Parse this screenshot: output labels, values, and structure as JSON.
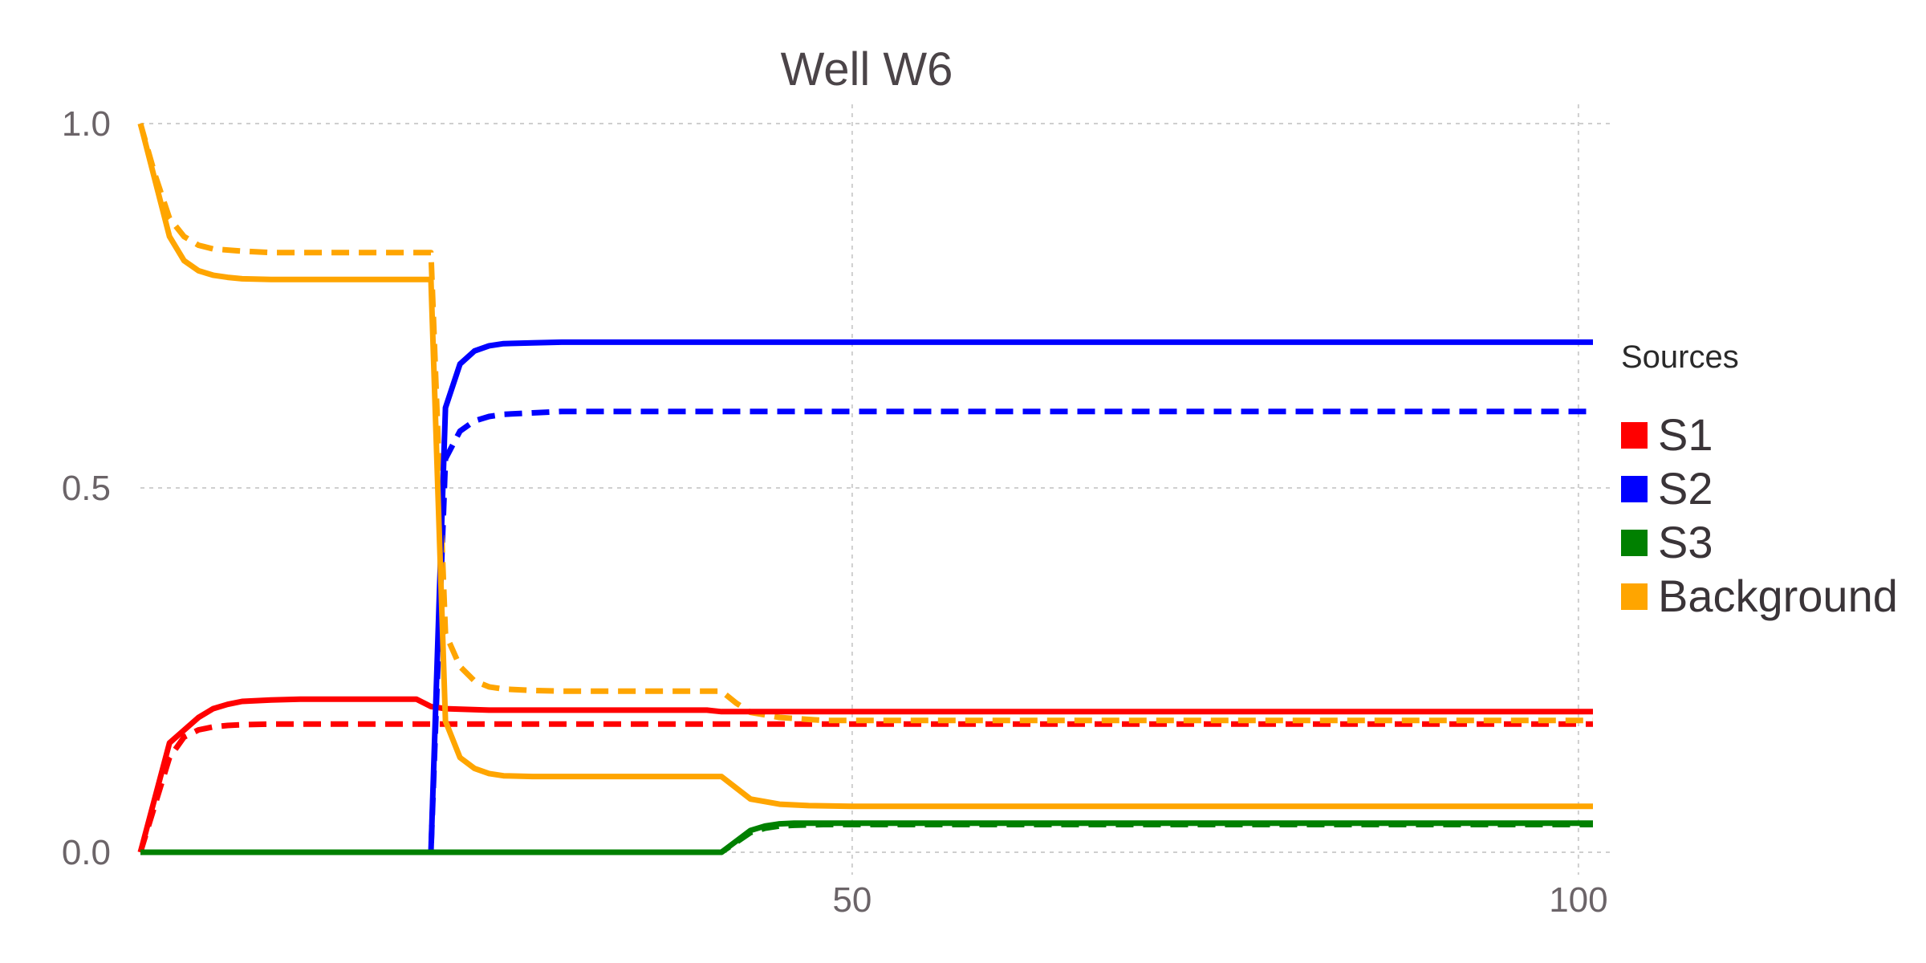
{
  "chart_data": {
    "type": "line",
    "title": "Well W6",
    "xlabel": "",
    "ylabel": "",
    "xlim": [
      1,
      101
    ],
    "ylim": [
      0.0,
      1.0
    ],
    "x_ticks": [
      50,
      100
    ],
    "x_tick_labels": [
      "50",
      "100"
    ],
    "y_ticks": [
      0.0,
      0.5,
      1.0
    ],
    "y_tick_labels": [
      "0.0",
      "0.5",
      "1.0"
    ],
    "grid": true,
    "legend": {
      "title": "Sources",
      "position": "right",
      "items": [
        "S1",
        "S2",
        "S3",
        "Background"
      ]
    },
    "line_styles": [
      "solid",
      "dashed"
    ],
    "series": [
      {
        "name": "S1",
        "style": "solid",
        "color": "#ff0000",
        "x": [
          1,
          3,
          5,
          6,
          7,
          8,
          10,
          12,
          15,
          20,
          21,
          22,
          25,
          30,
          40,
          41,
          101
        ],
        "y": [
          0.0,
          0.15,
          0.185,
          0.197,
          0.203,
          0.207,
          0.209,
          0.21,
          0.21,
          0.21,
          0.2,
          0.197,
          0.195,
          0.195,
          0.195,
          0.193,
          0.193
        ]
      },
      {
        "name": "S1",
        "style": "dashed",
        "color": "#ff0000",
        "x": [
          1,
          3,
          4,
          5,
          6,
          7,
          8,
          10,
          15,
          20,
          101
        ],
        "y": [
          0.0,
          0.13,
          0.158,
          0.168,
          0.172,
          0.174,
          0.175,
          0.176,
          0.176,
          0.176,
          0.176
        ]
      },
      {
        "name": "S2",
        "style": "solid",
        "color": "#0000ff",
        "x": [
          1,
          21,
          22,
          23,
          24,
          25,
          26,
          28,
          30,
          101
        ],
        "y": [
          0.0,
          0.0,
          0.61,
          0.67,
          0.688,
          0.695,
          0.698,
          0.699,
          0.7,
          0.7
        ]
      },
      {
        "name": "S2",
        "style": "dashed",
        "color": "#0000ff",
        "x": [
          1,
          21,
          22,
          23,
          24,
          25,
          26,
          28,
          30,
          101
        ],
        "y": [
          0.0,
          0.0,
          0.54,
          0.578,
          0.592,
          0.598,
          0.601,
          0.603,
          0.605,
          0.605
        ]
      },
      {
        "name": "S3",
        "style": "solid",
        "color": "#008000",
        "x": [
          1,
          41,
          43,
          44,
          45,
          46,
          48,
          101
        ],
        "y": [
          0.0,
          0.0,
          0.03,
          0.036,
          0.039,
          0.04,
          0.04,
          0.04
        ]
      },
      {
        "name": "S3",
        "style": "dashed",
        "color": "#008000",
        "x": [
          1,
          41,
          43,
          44,
          45,
          46,
          48,
          101
        ],
        "y": [
          0.0,
          0.0,
          0.027,
          0.033,
          0.036,
          0.037,
          0.038,
          0.038
        ]
      },
      {
        "name": "Background",
        "style": "solid",
        "color": "#ffa500",
        "x": [
          1,
          3,
          4,
          5,
          6,
          7,
          8,
          10,
          15,
          20,
          21,
          22,
          23,
          24,
          25,
          26,
          28,
          30,
          40,
          41,
          43,
          45,
          47,
          50,
          101
        ],
        "y": [
          1.0,
          0.845,
          0.812,
          0.798,
          0.792,
          0.789,
          0.787,
          0.786,
          0.786,
          0.786,
          0.786,
          0.18,
          0.13,
          0.115,
          0.108,
          0.105,
          0.104,
          0.104,
          0.104,
          0.104,
          0.073,
          0.066,
          0.064,
          0.063,
          0.063
        ]
      },
      {
        "name": "Background",
        "style": "dashed",
        "color": "#ffa500",
        "x": [
          1,
          2,
          3,
          4,
          5,
          6,
          8,
          10,
          15,
          20,
          21,
          22,
          23,
          24,
          25,
          26,
          28,
          30,
          40,
          41,
          42,
          43,
          45,
          48,
          101
        ],
        "y": [
          1.0,
          0.93,
          0.87,
          0.845,
          0.833,
          0.828,
          0.825,
          0.823,
          0.823,
          0.823,
          0.823,
          0.3,
          0.255,
          0.235,
          0.227,
          0.224,
          0.222,
          0.221,
          0.221,
          0.221,
          0.205,
          0.192,
          0.185,
          0.181,
          0.181
        ]
      }
    ]
  }
}
